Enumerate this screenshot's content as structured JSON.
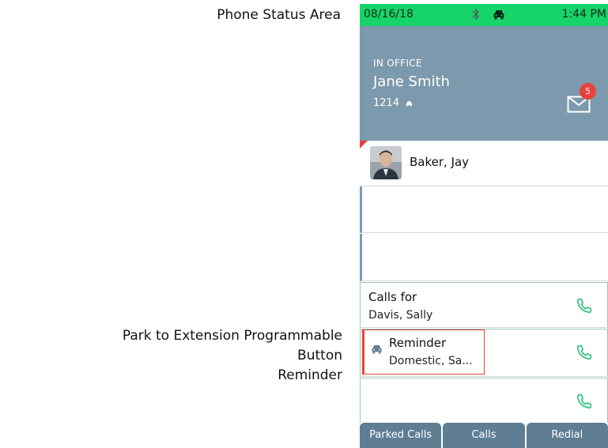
{
  "callouts": {
    "status_area": "Phone Status Area",
    "park_button_line1": "Park to Extension Programmable Button",
    "park_button_line2": "Reminder"
  },
  "status_bar": {
    "date": "08/16/18",
    "time": "1:44 PM",
    "icons": [
      "bluetooth-icon",
      "car-icon"
    ],
    "color": "#17d46a"
  },
  "header": {
    "presence": "IN OFFICE",
    "user_name": "Jane Smith",
    "extension": "1214",
    "voicemail_count": "5",
    "color": "#7d99ad"
  },
  "lines": [
    {
      "label": "Baker, Jay"
    },
    {
      "label": ""
    },
    {
      "label": ""
    },
    {
      "title": "Calls for",
      "subtitle": "Davis, Sally"
    },
    {
      "title": "Reminder",
      "subtitle": "Domestic, Sa..."
    },
    {
      "label": ""
    }
  ],
  "softkeys": [
    "Parked Calls",
    "Calls",
    "Redial"
  ],
  "colors": {
    "accent_red": "#e8433a",
    "call_green": "#2ec27e",
    "softkey_bg": "#5f7d93"
  }
}
